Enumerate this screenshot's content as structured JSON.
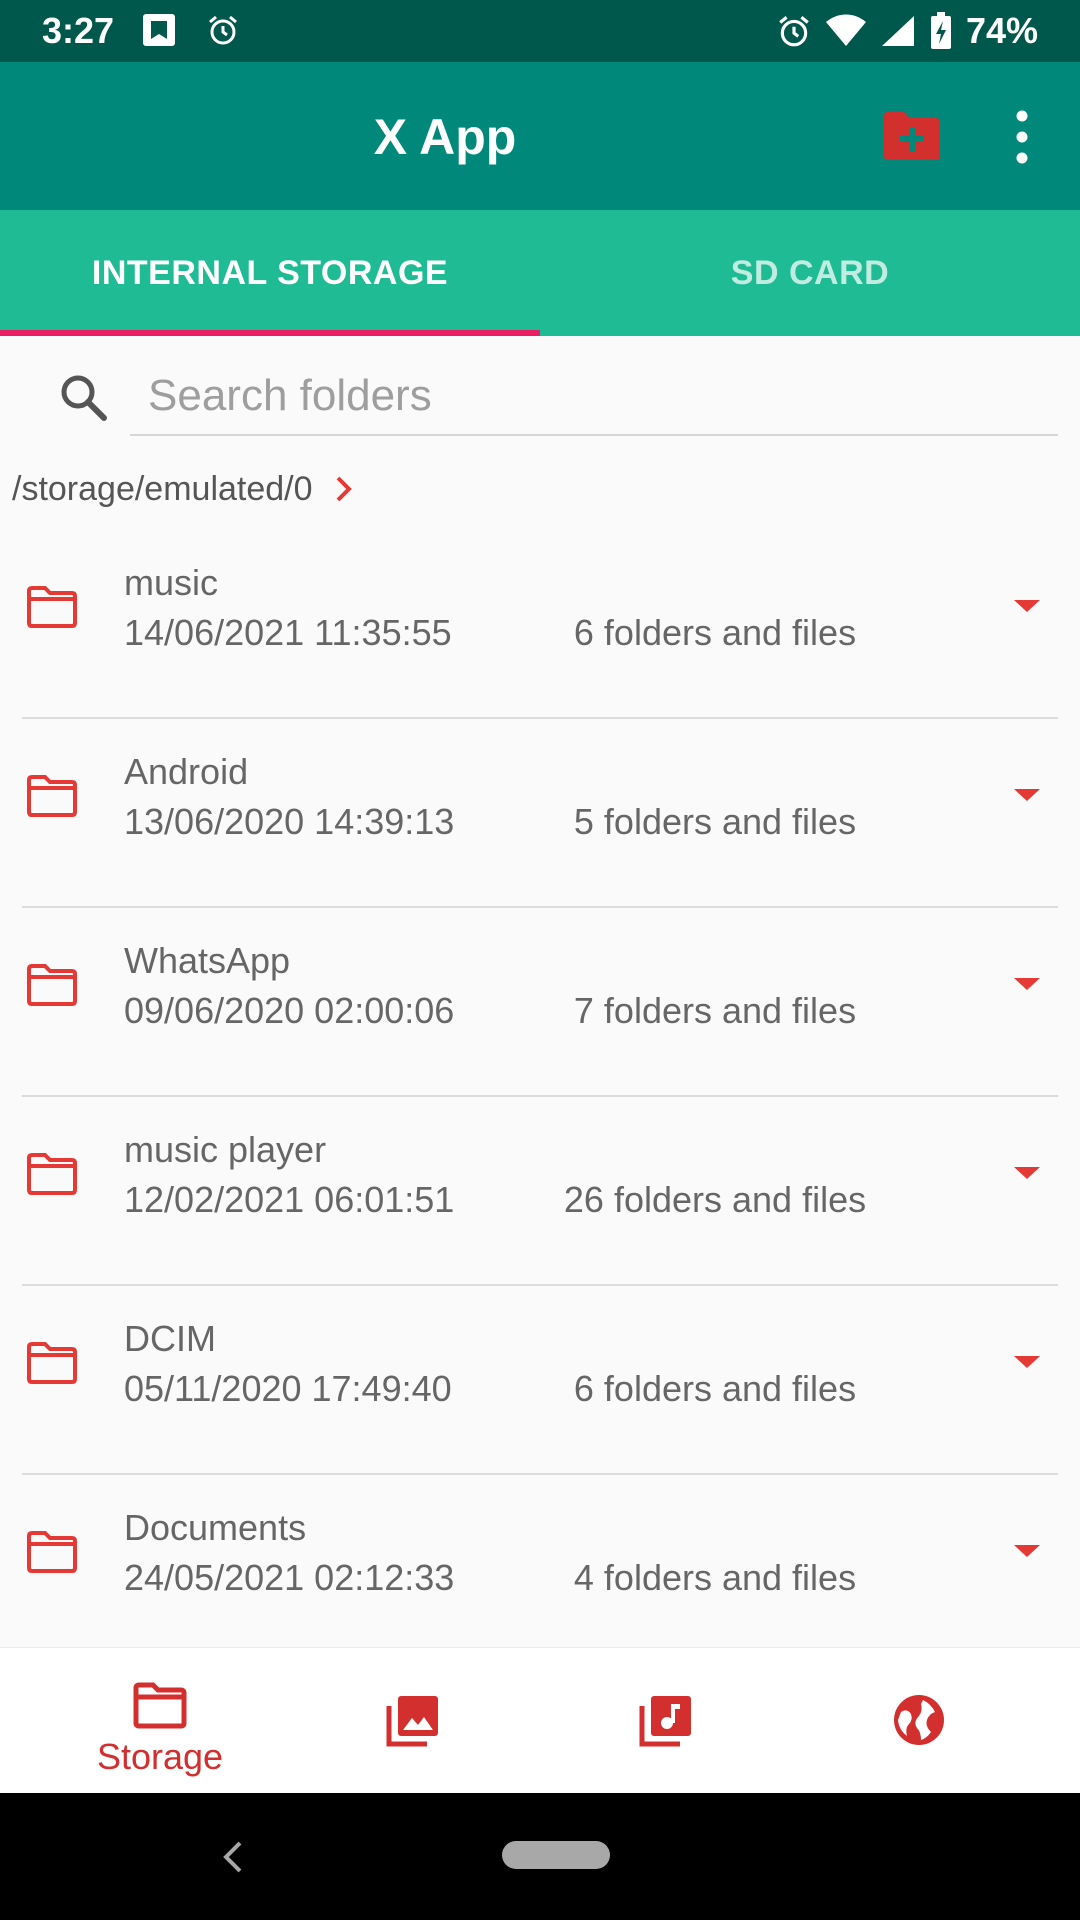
{
  "status_bar": {
    "time": "3:27",
    "battery": "74%",
    "icons": [
      "notification-icon",
      "alarm-icon",
      "alarm-clock-icon",
      "wifi-icon",
      "signal-icon",
      "battery-charging-icon"
    ]
  },
  "app_bar": {
    "title": "X App",
    "actions": [
      "new-folder-icon",
      "more-vert-icon"
    ]
  },
  "tabs": [
    {
      "label": "INTERNAL STORAGE",
      "selected": true
    },
    {
      "label": "SD CARD",
      "selected": false
    }
  ],
  "search": {
    "placeholder": "Search folders",
    "value": ""
  },
  "breadcrumb": {
    "path": "/storage/emulated/0"
  },
  "folders": [
    {
      "name": "music",
      "date": "14/06/2021 11:35:55",
      "count": "6 folders and files"
    },
    {
      "name": "Android",
      "date": "13/06/2020 14:39:13",
      "count": "5 folders and files"
    },
    {
      "name": "WhatsApp",
      "date": "09/06/2020 02:00:06",
      "count": "7 folders and files"
    },
    {
      "name": "music player",
      "date": "12/02/2021 06:01:51",
      "count": "26 folders and files"
    },
    {
      "name": "DCIM",
      "date": "05/11/2020 17:49:40",
      "count": "6 folders and files"
    },
    {
      "name": "Documents",
      "date": "24/05/2021 02:12:33",
      "count": "4 folders and files"
    }
  ],
  "bottom_nav": [
    {
      "label": "Storage",
      "icon": "folder-icon",
      "active": true
    },
    {
      "label": "",
      "icon": "photo-library-icon",
      "active": false
    },
    {
      "label": "",
      "icon": "music-library-icon",
      "active": false
    },
    {
      "label": "",
      "icon": "globe-icon",
      "active": false
    }
  ],
  "colors": {
    "status_bar": "#00574b",
    "app_bar": "#00897b",
    "tab_bar": "#1fbb94",
    "tab_indicator": "#e91e63",
    "accent_red": "#e53935"
  }
}
